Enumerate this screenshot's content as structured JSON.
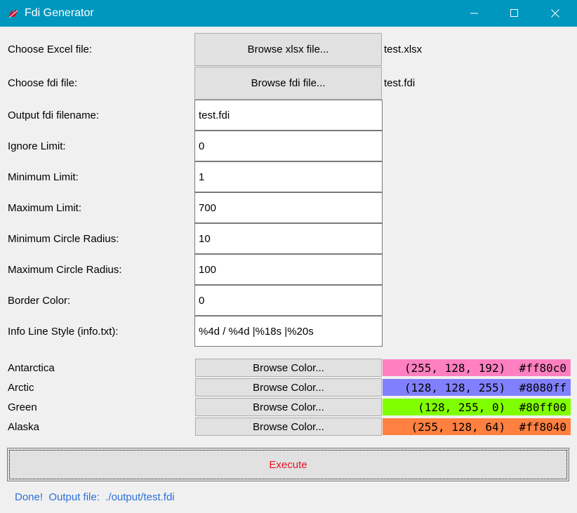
{
  "window": {
    "title": "Fdi Generator",
    "icon": "tk-feather-icon"
  },
  "excel": {
    "label": "Choose Excel file:",
    "button": "Browse xlsx file...",
    "selected": "test.xlsx"
  },
  "fdi": {
    "label": "Choose fdi file:",
    "button": "Browse fdi file...",
    "selected": "test.fdi"
  },
  "fields": {
    "output_filename": {
      "label": "Output fdi filename:",
      "value": "test.fdi"
    },
    "ignore_limit": {
      "label": "Ignore Limit:",
      "value": "0"
    },
    "minimum_limit": {
      "label": "Minimum Limit:",
      "value": "1"
    },
    "maximum_limit": {
      "label": "Maximum Limit:",
      "value": "700"
    },
    "min_circle_radius": {
      "label": "Minimum Circle Radius:",
      "value": "10"
    },
    "max_circle_radius": {
      "label": "Maximum Circle Radius:",
      "value": "100"
    },
    "border_color": {
      "label": "Border Color:",
      "value": "0"
    },
    "info_line_style": {
      "label": "Info Line Style (info.txt):",
      "value": "%4d / %4d |%18s |%20s"
    }
  },
  "colors": [
    {
      "name": "Antarctica",
      "button": "Browse Color...",
      "value": "(255, 128, 192)  #ff80c0",
      "hex": "#ff80c0"
    },
    {
      "name": "Arctic",
      "button": "Browse Color...",
      "value": "(128, 128, 255)  #8080ff",
      "hex": "#8080ff"
    },
    {
      "name": "Green",
      "button": "Browse Color...",
      "value": "(128, 255, 0)  #80ff00",
      "hex": "#80ff00"
    },
    {
      "name": "Alaska",
      "button": "Browse Color...",
      "value": "(255, 128, 64)  #ff8040",
      "hex": "#ff8040"
    }
  ],
  "execute": {
    "label": "Execute",
    "color": "#e81123"
  },
  "status": {
    "text": "Done!  Output file:  ./output/test.fdi",
    "color": "#2f6fd8"
  }
}
